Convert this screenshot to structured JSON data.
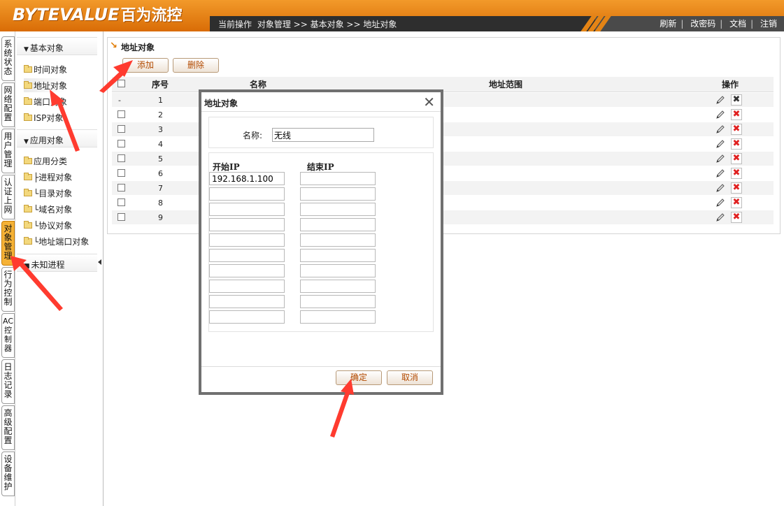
{
  "header": {
    "logo_en": "BYTEVALUE",
    "logo_cn": "百为流控",
    "breadcrumb": [
      "当前操作",
      "对象管理 >> 基本对象 >> 地址对象"
    ],
    "links": [
      "刷新",
      "改密码",
      "文档",
      "注销"
    ]
  },
  "vtabs": [
    {
      "label": "系统状态",
      "active": false
    },
    {
      "label": "网络配置",
      "active": false
    },
    {
      "label": "用户管理",
      "active": false
    },
    {
      "label": "认证上网",
      "active": false
    },
    {
      "label": "对象管理",
      "active": true
    },
    {
      "label": "行为控制",
      "active": false
    },
    {
      "label": "AC控制器",
      "active": false
    },
    {
      "label": "日志记录",
      "active": false
    },
    {
      "label": "高级配置",
      "active": false
    },
    {
      "label": "设备维护",
      "active": false
    }
  ],
  "tree": {
    "section_basic": "基本对象",
    "basic_items": [
      "时间对象",
      "地址对象",
      "端口对象",
      "ISP对象"
    ],
    "section_app": "应用对象",
    "app_items": [
      "应用分类",
      "├进程对象",
      "└目录对象",
      "└域名对象",
      "└协议对象",
      "└地址端口对象"
    ],
    "unknown": "未知进程"
  },
  "panel": {
    "title": "地址对象",
    "add_label": "添加",
    "delete_label": "删除",
    "columns": {
      "index": "序号",
      "name": "名称",
      "range": "地址范围",
      "ops": "操作"
    },
    "rows": [
      {
        "first": "-",
        "index": "1"
      },
      {
        "first": "",
        "index": "2"
      },
      {
        "first": "",
        "index": "3"
      },
      {
        "first": "",
        "index": "4"
      },
      {
        "first": "",
        "index": "5"
      },
      {
        "first": "",
        "index": "6"
      },
      {
        "first": "",
        "index": "7"
      },
      {
        "first": "",
        "index": "8"
      },
      {
        "first": "",
        "index": "9"
      }
    ]
  },
  "dialog": {
    "title": "地址对象",
    "close": "✕",
    "name_label": "名称:",
    "name_value": "无线",
    "start_ip_label": "开始IP",
    "end_ip_label": "结束IP",
    "start_ips": [
      "192.168.1.100",
      "",
      "",
      "",
      "",
      "",
      "",
      "",
      "",
      ""
    ],
    "end_ips": [
      "",
      "",
      "",
      "",
      "",
      "",
      "",
      "",
      "",
      ""
    ],
    "ok_label": "确定",
    "cancel_label": "取消"
  },
  "colors": {
    "header_orange": "#e07b0c",
    "active_tab": "#f5b236",
    "arrow_red": "#ff3b2f",
    "button_text": "#b24a00"
  }
}
